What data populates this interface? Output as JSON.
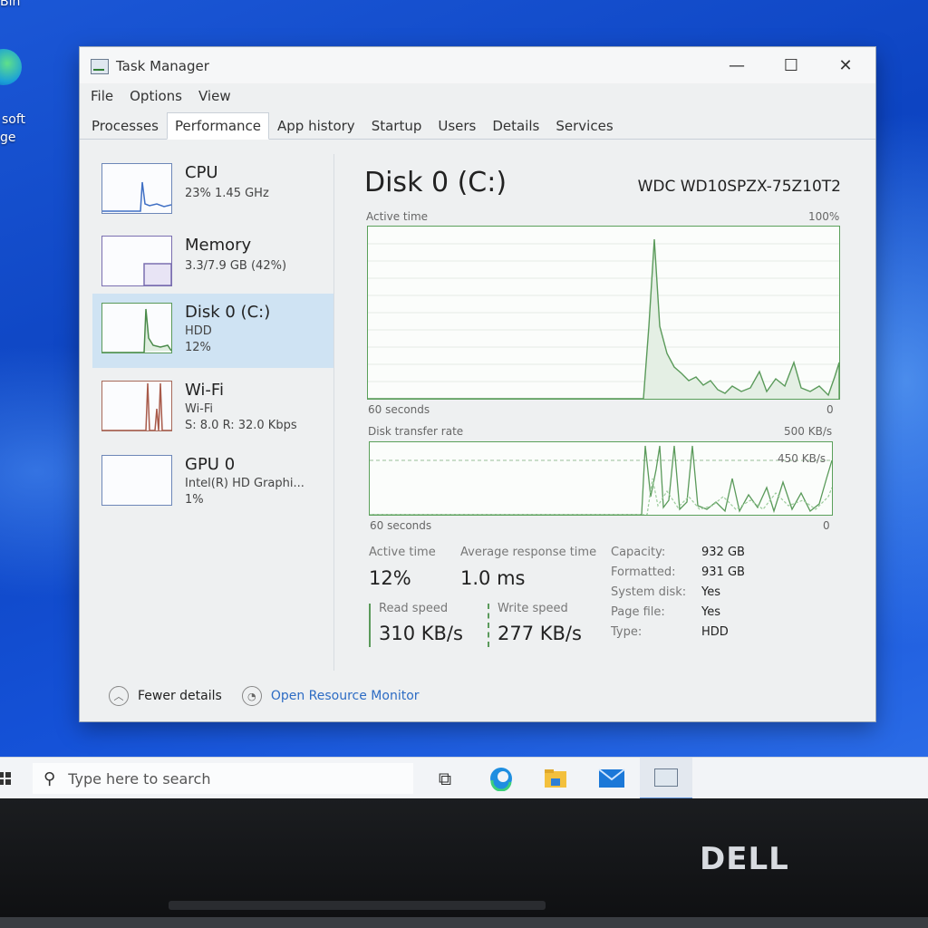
{
  "desktop": {
    "icon_label_top": "Bin",
    "icon_label_line1": "soft",
    "icon_label_line2": "ge"
  },
  "window": {
    "title": "Task Manager",
    "controls": {
      "minimize": "—",
      "maximize": "☐",
      "close": "✕"
    },
    "menu": [
      "File",
      "Options",
      "View"
    ],
    "tabs": [
      "Processes",
      "Performance",
      "App history",
      "Startup",
      "Users",
      "Details",
      "Services"
    ],
    "active_tab": "Performance"
  },
  "sidebar": {
    "items": [
      {
        "title": "CPU",
        "sub1": "23%  1.45 GHz",
        "sub2": ""
      },
      {
        "title": "Memory",
        "sub1": "3.3/7.9 GB (42%)",
        "sub2": ""
      },
      {
        "title": "Disk 0 (C:)",
        "sub1": "HDD",
        "sub2": "12%"
      },
      {
        "title": "Wi-Fi",
        "sub1": "Wi-Fi",
        "sub2": "S: 8.0  R: 32.0 Kbps"
      },
      {
        "title": "GPU 0",
        "sub1": "Intel(R) HD Graphi...",
        "sub2": "1%"
      }
    ],
    "selected": "Disk 0 (C:)"
  },
  "main": {
    "title": "Disk 0 (C:)",
    "model": "WDC WD10SPZX-75Z10T2",
    "graph1": {
      "label": "Active time",
      "max": "100%",
      "time": "60 seconds",
      "min": "0"
    },
    "graph2": {
      "label": "Disk transfer rate",
      "max": "500 KB/s",
      "mid": "450 KB/s",
      "time": "60 seconds",
      "min": "0"
    },
    "stats": {
      "active_time_label": "Active time",
      "active_time": "12%",
      "avg_response_label": "Average response time",
      "avg_response": "1.0 ms",
      "read_label": "Read speed",
      "read": "310 KB/s",
      "write_label": "Write speed",
      "write": "277 KB/s"
    },
    "properties": [
      {
        "name": "Capacity:",
        "value": "932 GB"
      },
      {
        "name": "Formatted:",
        "value": "931 GB"
      },
      {
        "name": "System disk:",
        "value": "Yes"
      },
      {
        "name": "Page file:",
        "value": "Yes"
      },
      {
        "name": "Type:",
        "value": "HDD"
      }
    ]
  },
  "footer": {
    "fewer_details": "Fewer details",
    "open_resource_monitor": "Open Resource Monitor"
  },
  "taskbar": {
    "search_placeholder": "Type here to search"
  },
  "bezel": {
    "brand": "DELL"
  },
  "colors": {
    "accent": "#2d6cc4",
    "graph_line": "#5a9a5a",
    "selected_bg": "#cfe3f3"
  }
}
